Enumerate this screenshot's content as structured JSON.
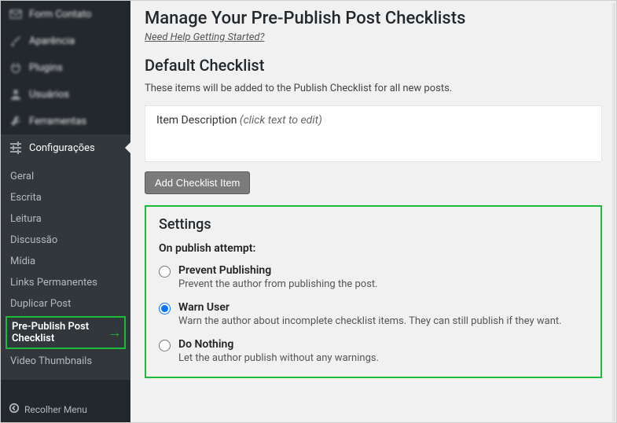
{
  "sidebar": {
    "blurred": [
      {
        "icon": "mail",
        "label": "Form Contato"
      },
      {
        "icon": "brush",
        "label": "Aparência"
      },
      {
        "icon": "plug",
        "label": "Plugins"
      },
      {
        "icon": "user",
        "label": "Usuários"
      },
      {
        "icon": "tool",
        "label": "Ferramentas"
      }
    ],
    "active": {
      "icon": "sliders",
      "label": "Configurações"
    },
    "submenu": [
      "Geral",
      "Escrita",
      "Leitura",
      "Discussão",
      "Mídia",
      "Links Permanentes",
      "Duplicar Post"
    ],
    "highlighted": "Pre-Publish Post Checklist",
    "submenu_after": [
      "Video Thumbnails"
    ],
    "collapse": "Recolher Menu"
  },
  "page": {
    "title": "Manage Your Pre-Publish Post Checklists",
    "help": "Need Help Getting Started?",
    "section": "Default Checklist",
    "desc": "These items will be added to the Publish Checklist for all new posts.",
    "item_label": "Item Description",
    "item_hint": "(click text to edit)",
    "add_btn": "Add Checklist Item",
    "settings_title": "Settings",
    "settings_sub": "On publish attempt:",
    "options": [
      {
        "label": "Prevent Publishing",
        "desc": "Prevent the author from publishing the post.",
        "checked": false
      },
      {
        "label": "Warn User",
        "desc": "Warn the author about incomplete checklist items. They can still publish if they want.",
        "checked": true
      },
      {
        "label": "Do Nothing",
        "desc": "Let the author publish without any warnings.",
        "checked": false
      }
    ]
  }
}
